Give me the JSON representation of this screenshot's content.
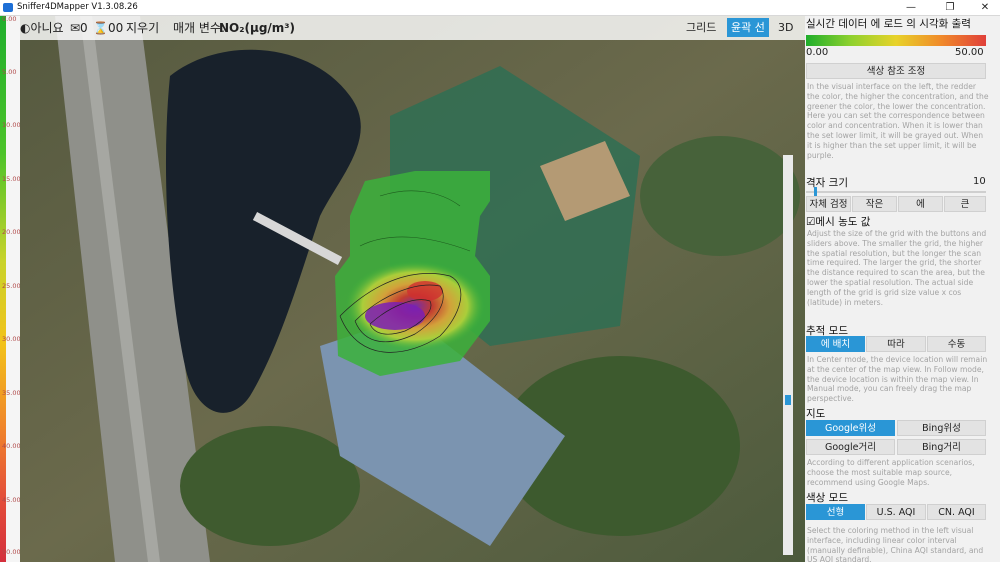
{
  "window": {
    "title": "Sniffer4DMapper V1.3.08.26",
    "minimize": "—",
    "restore": "❐",
    "close": "✕"
  },
  "toolbar": {
    "items": [
      "◐아니요",
      "✉0",
      "⌛00",
      "지우기",
      "매개 변수:"
    ],
    "param_value": "NO₂(μg/m³)",
    "view_buttons": [
      "그리드",
      "윤곽 선",
      "3D"
    ]
  },
  "scale": {
    "labels": [
      "0.00",
      "5.00",
      "10.00",
      "15.00",
      "20.00",
      "25.00",
      "30.00",
      "35.00",
      "40.00",
      "45.00",
      "50.00"
    ]
  },
  "panel": {
    "title": "실시간 데이터 에 로드 의 시각화 출력",
    "gradient_min": "0.00",
    "gradient_max": "50.00",
    "color_adjust_button": "색상 참조 조정",
    "color_desc": "In the visual interface on the left, the redder the color, the higher the concentration, and the greener the color, the lower the concentration. Here you can set the correspondence between color and concentration. When it is lower than the set lower limit, it will be grayed out. When it is higher than the set upper limit, it will be purple.",
    "grid_size_label": "격자 크기",
    "grid_size_value": "10",
    "grid_buttons": [
      "자체 검정",
      "작은",
      "에",
      "큰"
    ],
    "mesh_checkbox": "☑메시 농도 값",
    "grid_desc": "Adjust the size of the grid with the buttons and sliders above. The smaller the grid, the higher the spatial resolution, but the longer the scan time required. The larger the grid, the shorter the distance required to scan the area, but the lower the spatial resolution. The actual side length of the grid is grid size value x cos (latitude) in meters.",
    "tracking_label": "추적 모드",
    "tracking_buttons": [
      "에 배치",
      "따라",
      "수동"
    ],
    "tracking_desc": "In Center mode, the device location will remain at the center of the map view. In Follow mode, the device location is within the map view. In Manual mode, you can freely drag the map perspective.",
    "map_label": "지도",
    "map_buttons": [
      "Google위성",
      "Bing위성",
      "Google거리",
      "Bing거리"
    ],
    "map_desc": "According to different application scenarios, choose the most suitable map source, recommend using Google Maps.",
    "color_mode_label": "색상 모드",
    "color_mode_buttons": [
      "선형",
      "U.S. AQI",
      "CN. AQI"
    ],
    "color_mode_desc": "Select the coloring method in the left visual interface, including linear color interval (manually definable), China AQI standard, and US AQI standard."
  },
  "colors": {
    "accent": "#2a96d6",
    "gradient_start": "#1fae2c",
    "gradient_end": "#d42f3c"
  }
}
